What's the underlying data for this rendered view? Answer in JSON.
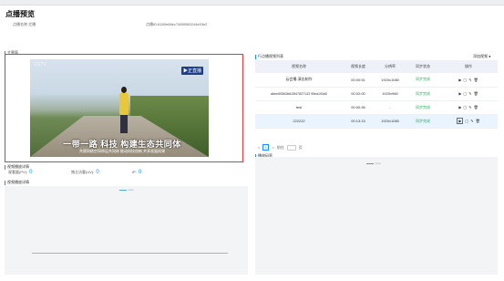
{
  "page": {
    "title": "点播预览",
    "sub_left": "点播名称:尤播",
    "sub_right": "点播ID:6180e66ec7485f365244e53e2"
  },
  "player": {
    "section": "主界面",
    "logo_tl": "CCTV",
    "logo_tr": "▶正直播",
    "caption_big": "一带一路 科技 构建生态共同体",
    "caption_small": "共建网络空间命运共同体 推动科技创新 共享发展成果"
  },
  "stats": {
    "section": "视频播放详情",
    "pv_label": "观看量(PV):",
    "pv": "0",
    "uv_label": "独立访客(UV):",
    "uv": "0",
    "ip_label": "IP:",
    "ip": "0"
  },
  "detail": {
    "section": "视频播放详情",
    "legend": "Line"
  },
  "list": {
    "section": "行点播视频列表",
    "add_label": "添加视频",
    "headers": [
      "视频名称",
      "视频长度",
      "分辨率",
      "同步状态",
      "操作"
    ],
    "rows": [
      {
        "name": "云会播-演出制作",
        "length": "00:00:51",
        "res": "1920x1080",
        "status": "同步完成"
      },
      {
        "name": "a6ee505638d15f47827133 95ea193d0",
        "length": "00:02:00",
        "res": "1920x960",
        "status": "同步完成"
      },
      {
        "name": "test",
        "length": "00:00:36",
        "res": "-",
        "status": "同步完成"
      },
      {
        "name": "222222",
        "length": "00:13:15",
        "res": "1920x1080",
        "status": "同步完成"
      }
    ],
    "ops": [
      "▶",
      "▢",
      "✎",
      "🗑"
    ]
  },
  "pager": {
    "prev": "<",
    "page": "1",
    "next": ">",
    "goto": "前往",
    "unit": "页"
  },
  "rate": {
    "section": "播放码率",
    "legend": "Line"
  }
}
